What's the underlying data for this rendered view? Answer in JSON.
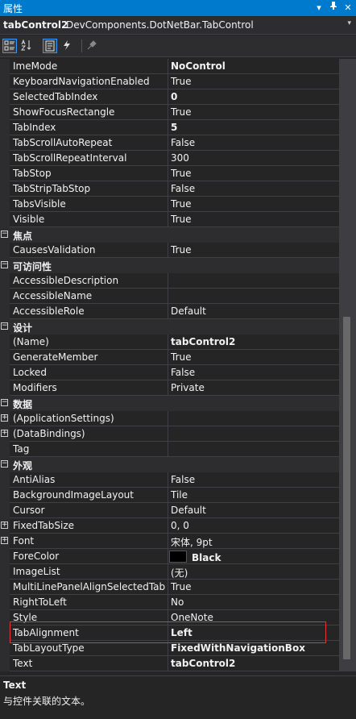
{
  "window": {
    "title": "属性",
    "dropdown_glyph": "▾",
    "pin_glyph": "ᚁ",
    "close_glyph": "✕"
  },
  "object_selector": {
    "name": "tabControl2",
    "type": "DevComponents.DotNetBar.TabControl",
    "dropdown_glyph": "▾"
  },
  "toolbar": {
    "buttons": [
      "categorized-icon",
      "alphabetical-icon",
      "properties-icon",
      "events-icon",
      "property-pages-icon"
    ]
  },
  "rows": [
    {
      "name": "ImeMode",
      "value": "NoControl",
      "bold": true
    },
    {
      "name": "KeyboardNavigationEnabled",
      "value": "True"
    },
    {
      "name": "SelectedTabIndex",
      "value": "0",
      "bold": true
    },
    {
      "name": "ShowFocusRectangle",
      "value": "True"
    },
    {
      "name": "TabIndex",
      "value": "5",
      "bold": true
    },
    {
      "name": "TabScrollAutoRepeat",
      "value": "False"
    },
    {
      "name": "TabScrollRepeatInterval",
      "value": "300"
    },
    {
      "name": "TabStop",
      "value": "True"
    },
    {
      "name": "TabStripTabStop",
      "value": "False"
    },
    {
      "name": "TabsVisible",
      "value": "True"
    },
    {
      "name": "Visible",
      "value": "True"
    },
    {
      "category": "焦点"
    },
    {
      "name": "CausesValidation",
      "value": "True"
    },
    {
      "category": "可访问性"
    },
    {
      "name": "AccessibleDescription",
      "value": ""
    },
    {
      "name": "AccessibleName",
      "value": ""
    },
    {
      "name": "AccessibleRole",
      "value": "Default"
    },
    {
      "category": "设计"
    },
    {
      "name": "(Name)",
      "value": "tabControl2",
      "bold": true
    },
    {
      "name": "GenerateMember",
      "value": "True"
    },
    {
      "name": "Locked",
      "value": "False"
    },
    {
      "name": "Modifiers",
      "value": "Private"
    },
    {
      "category": "数据"
    },
    {
      "name": "(ApplicationSettings)",
      "value": "",
      "expandable": true
    },
    {
      "name": "(DataBindings)",
      "value": "",
      "expandable": true
    },
    {
      "name": "Tag",
      "value": ""
    },
    {
      "category": "外观"
    },
    {
      "name": "AntiAlias",
      "value": "False"
    },
    {
      "name": "BackgroundImageLayout",
      "value": "Tile"
    },
    {
      "name": "Cursor",
      "value": "Default"
    },
    {
      "name": "FixedTabSize",
      "value": "0, 0",
      "expandable": true
    },
    {
      "name": "Font",
      "value": "宋体, 9pt",
      "expandable": true
    },
    {
      "name": "ForeColor",
      "value": "Black",
      "bold": true,
      "swatch": "#000000"
    },
    {
      "name": "ImageList",
      "value": "(无)"
    },
    {
      "name": "MultiLinePanelAlignSelectedTab",
      "value": "True"
    },
    {
      "name": "RightToLeft",
      "value": "No"
    },
    {
      "name": "Style",
      "value": "OneNote"
    },
    {
      "name": "TabAlignment",
      "value": "Left",
      "bold": true
    },
    {
      "name": "TabLayoutType",
      "value": "FixedWithNavigationBox",
      "bold": true
    },
    {
      "name": "Text",
      "value": "tabControl2",
      "bold": true
    }
  ],
  "description": {
    "title": "Text",
    "text": "与控件关联的文本。"
  },
  "colors": {
    "accent": "#007acc",
    "highlight_box": "#e2363b",
    "background": "#252526"
  }
}
